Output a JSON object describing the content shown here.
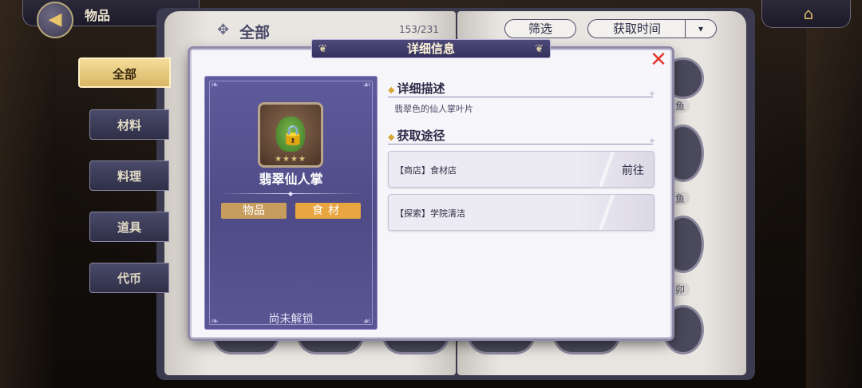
{
  "topbar": {
    "back_icon": "◀",
    "page_title": "物品",
    "home_icon": "⌂"
  },
  "tabs": [
    {
      "label": "全部",
      "active": true
    },
    {
      "label": "材料",
      "active": false
    },
    {
      "label": "料理",
      "active": false
    },
    {
      "label": "道具",
      "active": false
    },
    {
      "label": "代币",
      "active": false
    }
  ],
  "book": {
    "category_icon": "✥",
    "category": "全部",
    "count": "153/231",
    "filter_label": "筛选",
    "sort_label": "获取时间",
    "sort_arrow": "▾"
  },
  "peek_labels": [
    "鱼",
    "鱼",
    "卯"
  ],
  "modal": {
    "header": "详细信息",
    "close_icon": "✕",
    "item": {
      "name": "翡翠仙人掌",
      "stars": "★★★★",
      "tag_type": "物品",
      "tag_category": "食材",
      "locked_text": "尚未解锁",
      "lock_icon": "🔒"
    },
    "desc_title": "详细描述",
    "desc_text": "翡翠色的仙人掌叶片",
    "source_title": "获取途径",
    "routes": [
      {
        "text": "【商店】食材店",
        "action": "前往"
      },
      {
        "text": "【探索】学院清洁",
        "action": ""
      }
    ]
  }
}
